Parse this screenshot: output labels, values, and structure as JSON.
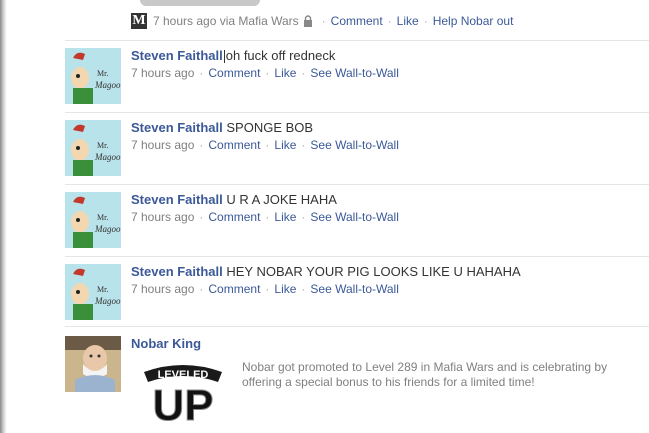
{
  "first_item": {
    "app_icon": "mafia-wars-icon",
    "app_icon_letter": "M",
    "time": "7 hours ago",
    "via_label": "via",
    "app_name": "Mafia Wars",
    "privacy_icon": "lock-icon",
    "actions": [
      "Comment",
      "Like",
      "Help Nobar out"
    ]
  },
  "posts": [
    {
      "author": "Steven Faithall",
      "message": "oh fuck off redneck",
      "time": "7 hours ago",
      "actions": [
        "Comment",
        "Like",
        "See Wall-to-Wall"
      ],
      "avatar_icon": "mr-magoo-avatar"
    },
    {
      "author": "Steven Faithall",
      "message": "SPONGE BOB",
      "time": "7 hours ago",
      "actions": [
        "Comment",
        "Like",
        "See Wall-to-Wall"
      ],
      "avatar_icon": "mr-magoo-avatar"
    },
    {
      "author": "Steven Faithall",
      "message": "U R A JOKE HAHA",
      "time": "7 hours ago",
      "actions": [
        "Comment",
        "Like",
        "See Wall-to-Wall"
      ],
      "avatar_icon": "mr-magoo-avatar"
    },
    {
      "author": "Steven Faithall",
      "message": "HEY NOBAR YOUR PIG LOOKS LIKE U HAHAHA",
      "time": "7 hours ago",
      "actions": [
        "Comment",
        "Like",
        "See Wall-to-Wall"
      ],
      "avatar_icon": "mr-magoo-avatar"
    }
  ],
  "promo": {
    "author": "Nobar King",
    "avatar_icon": "nobar-king-avatar",
    "image_icon": "leveled-up-image",
    "image_text_top": "LEVELED",
    "image_text_bottom": "UP",
    "text": "Nobar got promoted to Level 289 in Mafia Wars and is celebrating by offering a special bonus to his friends for a limited time!"
  },
  "colors": {
    "link": "#3b5998",
    "meta": "#808080",
    "separator": "#e5e5e5",
    "avatar_bg": "#b9e3ea"
  }
}
